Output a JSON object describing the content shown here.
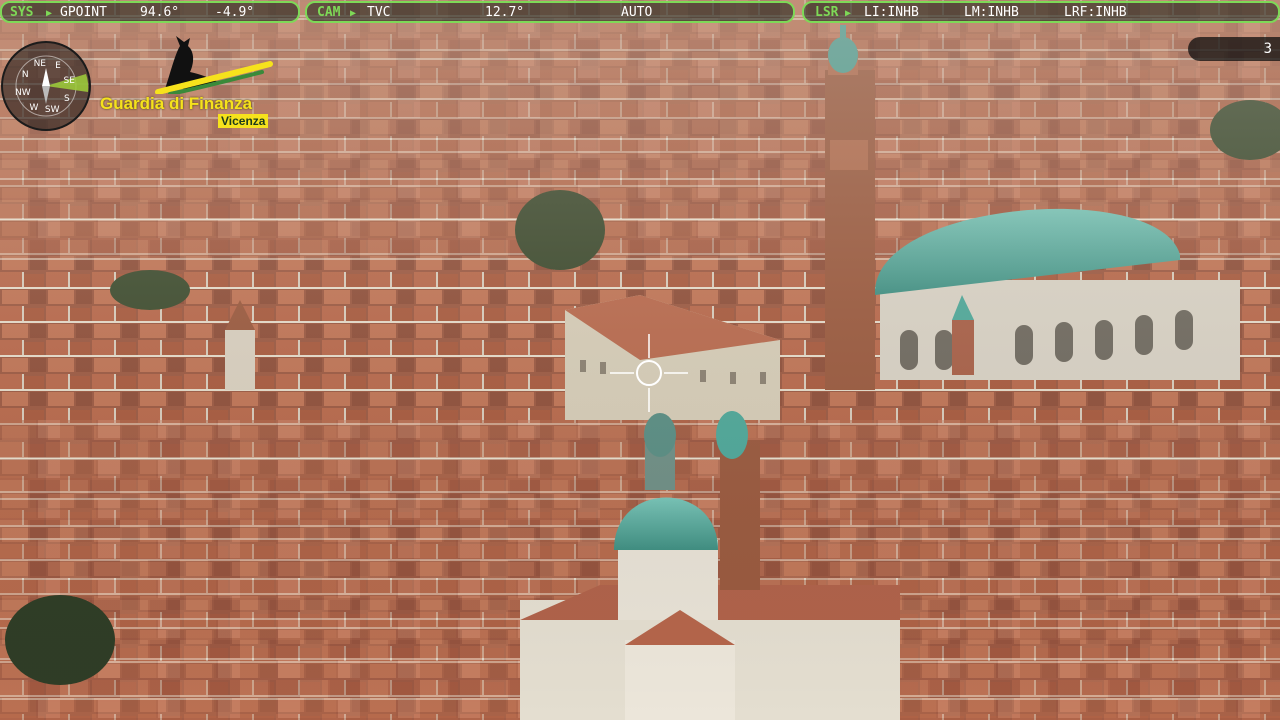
{
  "hud": {
    "sys": {
      "key": "SYS",
      "mode": "GPOINT",
      "azimuth": "94.6°",
      "elevation": "-4.9°"
    },
    "cam": {
      "key": "CAM",
      "sensor": "TVC",
      "fov": "12.7°",
      "focus": "AUTO"
    },
    "lsr": {
      "key": "LSR",
      "li": "LI:INHB",
      "lm": "LM:INHB",
      "lrf": "LRF:INHB"
    },
    "counter": "3"
  },
  "compass": {
    "labels": [
      "N",
      "NE",
      "E",
      "SE",
      "S",
      "SW",
      "W",
      "NW"
    ],
    "icon": "compass-rose-icon"
  },
  "logo": {
    "name": "Guardia di Finanza",
    "sub": "Vicenza",
    "icon": "griffin-emblem-icon"
  },
  "colors": {
    "hud_accent": "#7ed957",
    "logo_yellow": "#f6e21c",
    "dome": "#4fa89a",
    "roof": "#b0553a"
  },
  "crosshair": {
    "icon": "crosshair-reticle-icon"
  }
}
